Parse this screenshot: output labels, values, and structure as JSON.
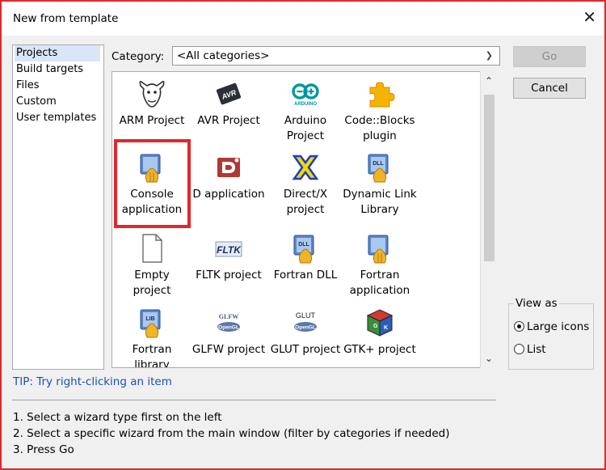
{
  "window": {
    "title": "New from template",
    "close_glyph": "✕"
  },
  "left_list": {
    "items": [
      {
        "label": "Projects",
        "selected": true
      },
      {
        "label": "Build targets",
        "selected": false
      },
      {
        "label": "Files",
        "selected": false
      },
      {
        "label": "Custom",
        "selected": false
      },
      {
        "label": "User templates",
        "selected": false
      }
    ]
  },
  "category": {
    "label": "Category:",
    "value": "<All categories>"
  },
  "buttons": {
    "go": "Go",
    "cancel": "Cancel"
  },
  "templates": [
    {
      "label": "ARM Project",
      "icon": "gnu-icon"
    },
    {
      "label": "AVR Project",
      "icon": "avr-chip-icon"
    },
    {
      "label": "Arduino Project",
      "icon": "arduino-icon"
    },
    {
      "label": "Code::Blocks plugin",
      "icon": "puzzle-piece-icon"
    },
    {
      "label": "Console application",
      "icon": "console-app-icon"
    },
    {
      "label": "D application",
      "icon": "d-logo-icon"
    },
    {
      "label": "Direct/X project",
      "icon": "directx-icon"
    },
    {
      "label": "Dynamic Link Library",
      "icon": "dll-icon"
    },
    {
      "label": "Empty project",
      "icon": "blank-page-icon"
    },
    {
      "label": "FLTK project",
      "icon": "fltk-icon"
    },
    {
      "label": "Fortran DLL",
      "icon": "dll-icon"
    },
    {
      "label": "Fortran application",
      "icon": "console-app-icon"
    },
    {
      "label": "Fortran library",
      "icon": "lib-icon"
    },
    {
      "label": "GLFW project",
      "icon": "glfw-opengl-icon"
    },
    {
      "label": "GLUT project",
      "icon": "glut-opengl-icon"
    },
    {
      "label": "GTK+ project",
      "icon": "gtk-cube-icon"
    }
  ],
  "view_as": {
    "title": "View as",
    "options": [
      {
        "label": "Large icons",
        "checked": true
      },
      {
        "label": "List",
        "checked": false
      }
    ]
  },
  "tip": "TIP: Try right-clicking an item",
  "instructions": [
    "1. Select a wizard type first on the left",
    "2. Select a specific wizard from the main window (filter by categories if needed)",
    "3. Press Go"
  ]
}
